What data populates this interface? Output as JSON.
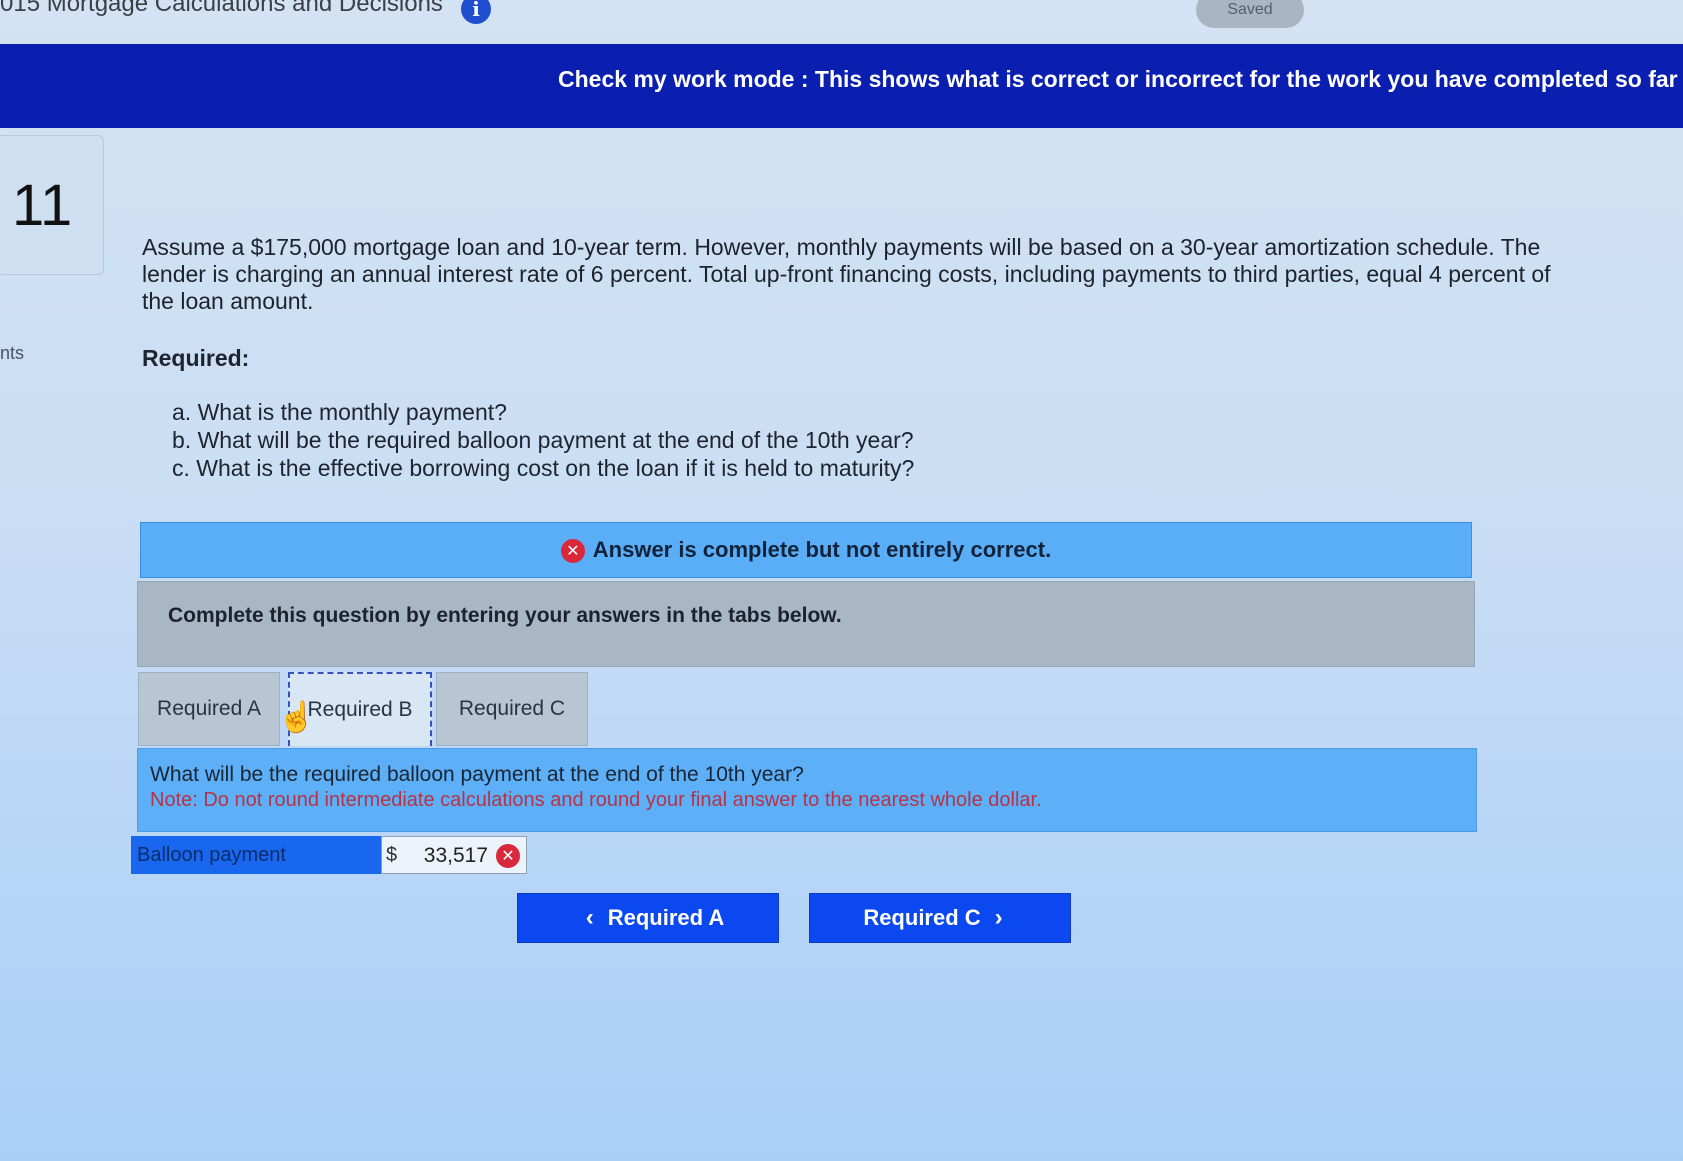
{
  "header": {
    "app_title": "015 Mortgage Calculations and Decisions",
    "info_icon_glyph": "i",
    "saved_label": "Saved"
  },
  "mode_banner": {
    "text": "Check my work mode : This shows what is correct or incorrect for the work you have completed so far"
  },
  "question": {
    "number": "11",
    "side_label": "nts",
    "prompt": "Assume a $175,000 mortgage loan and 10-year term. However, monthly payments will be based on a 30-year amortization schedule. The lender is charging an annual interest rate of 6 percent. Total up-front financing costs, including payments to third parties, equal 4 percent of the loan amount.",
    "required_label": "Required:",
    "items": [
      "a. What is the monthly payment?",
      "b. What will be the required balloon payment at the end of the 10th year?",
      "c. What is the effective borrowing cost on the loan if it is held to maturity?"
    ]
  },
  "feedback": {
    "status": "Answer is complete but not entirely correct.",
    "error_glyph": "✕",
    "instruction": "Complete this question by entering your answers in the tabs below."
  },
  "tabs": [
    {
      "label": "Required A"
    },
    {
      "label": "Required B"
    },
    {
      "label": "Required C"
    }
  ],
  "active_tab": "Required B",
  "tab_content": {
    "question": "What will be the required balloon payment at the end of the 10th year?",
    "note": "Note: Do not round intermediate calculations and round your final answer to the nearest whole dollar.",
    "row_label": "Balloon payment",
    "currency": "$",
    "value": "33,517"
  },
  "nav": {
    "prev_label": "Required A",
    "next_label": "Required C",
    "prev_glyph": "‹",
    "next_glyph": "›"
  },
  "colors": {
    "banner": "#0a1fb0",
    "answer_banner": "#5aaef7",
    "error": "#d9283b",
    "nav_button": "#0b48f0"
  }
}
